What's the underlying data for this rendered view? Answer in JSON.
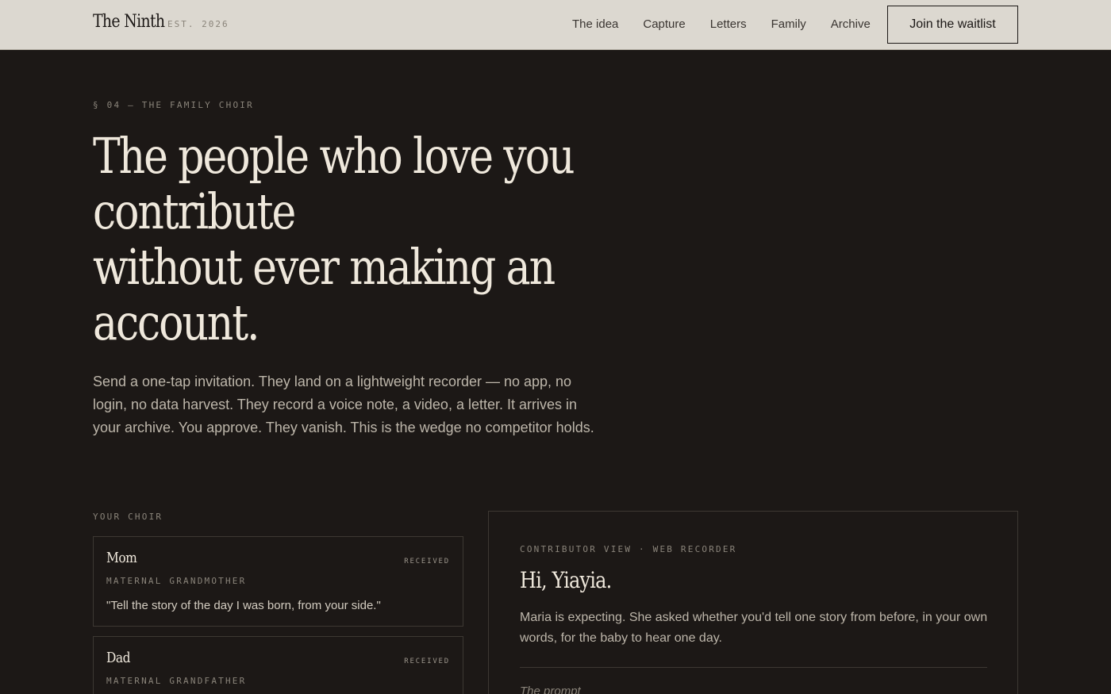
{
  "header": {
    "brand": "The Ninth",
    "established": "EST. 2026",
    "nav": [
      "The idea",
      "Capture",
      "Letters",
      "Family",
      "Archive"
    ],
    "cta_label": "Join the waitlist"
  },
  "hero": {
    "eyebrow": "§ 04 — THE FAMILY CHOIR",
    "headline_lines": [
      "The people who love you",
      "contribute",
      "without ever making an",
      "account."
    ],
    "lede": "Send a one-tap invitation. They land on a lightweight recorder — no app, no login, no data harvest. They record a voice note, a video, a letter. It arrives in your archive. You approve. They vanish. This is the wedge no competitor holds."
  },
  "choir": {
    "label": "YOUR CHOIR",
    "members": [
      {
        "name": "Mom",
        "status": "RECEIVED",
        "role": "MATERNAL GRANDMOTHER",
        "quote": "\"Tell the story of the day I was born, from your side.\""
      },
      {
        "name": "Dad",
        "status": "RECEIVED",
        "role": "MATERNAL GRANDFATHER",
        "quote": ""
      }
    ]
  },
  "contributor_panel": {
    "eyebrow": "CONTRIBUTOR VIEW · WEB RECORDER",
    "greeting": "Hi, Yiayia.",
    "body": "Maria is expecting. She asked whether you'd tell one story from before, in your own words, for the baby to hear one day.",
    "prompt_label": "The prompt"
  }
}
